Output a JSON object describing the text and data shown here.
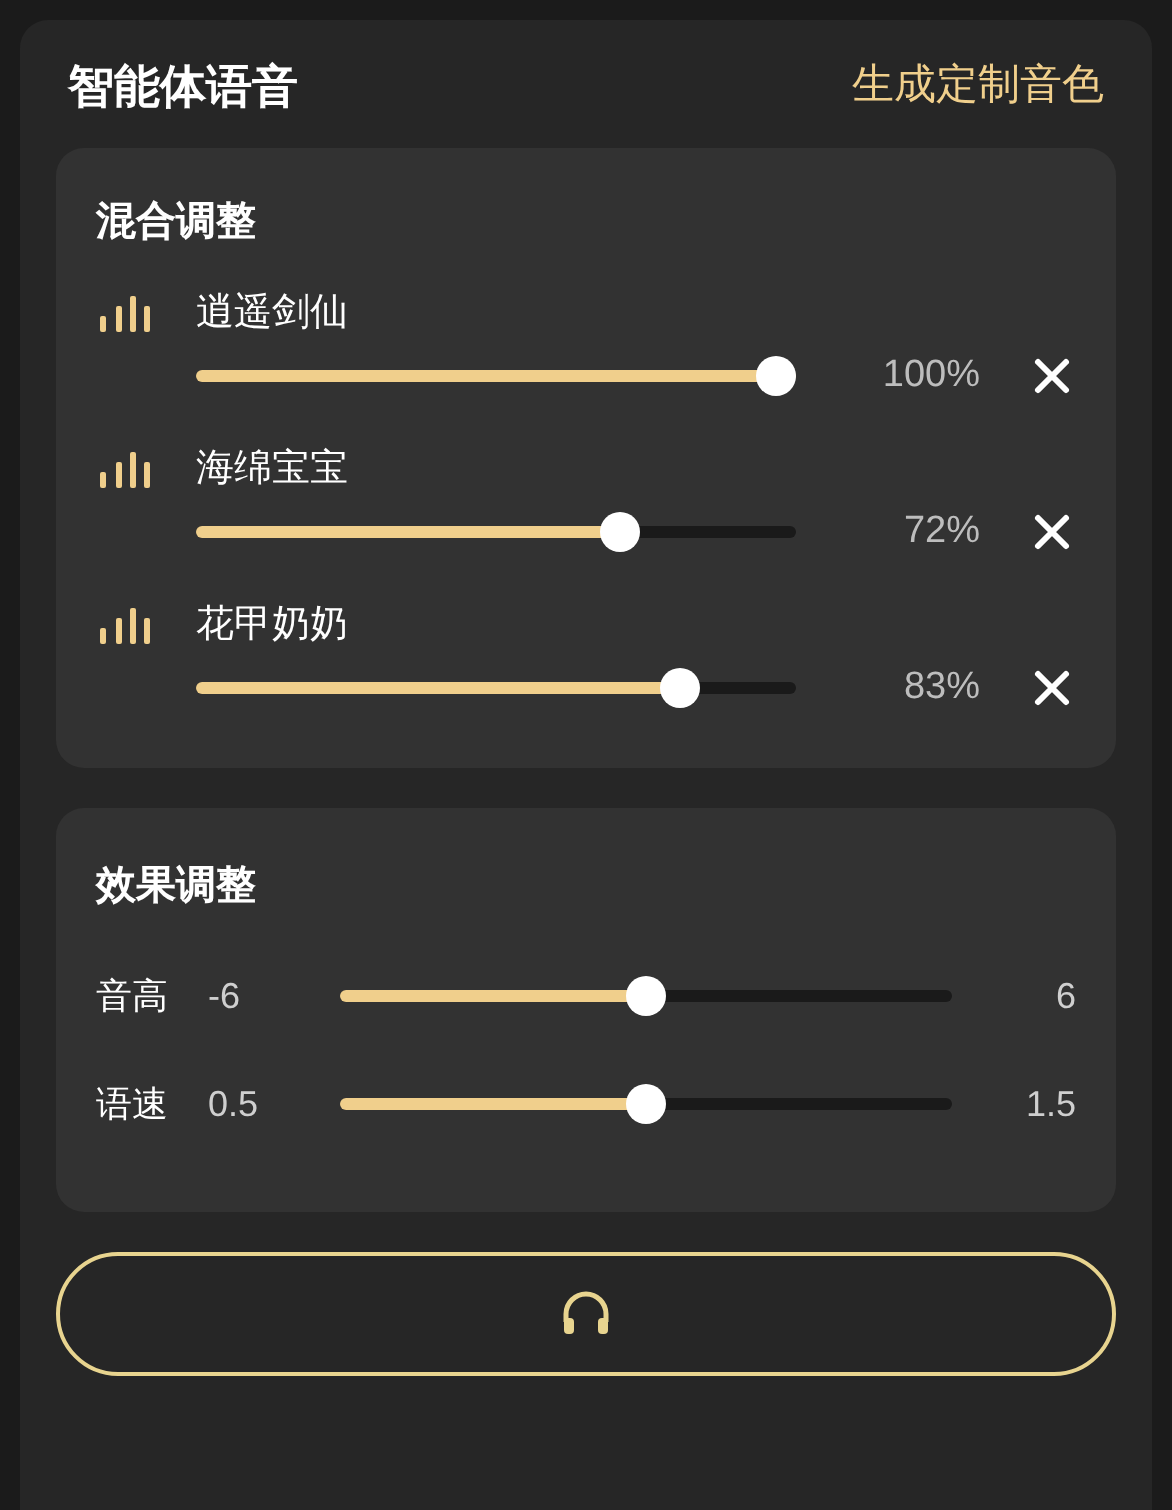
{
  "header": {
    "title": "智能体语音",
    "action": "生成定制音色"
  },
  "mix": {
    "title": "混合调整",
    "voices": [
      {
        "name": "逍遥剑仙",
        "level": 1.0,
        "reading": "100%"
      },
      {
        "name": "海绵宝宝",
        "level": 0.72,
        "reading": "72%"
      },
      {
        "name": "花甲奶奶",
        "level": 0.83,
        "reading": "83%"
      }
    ]
  },
  "effects": {
    "title": "效果调整",
    "sliders": [
      {
        "label": "音高",
        "min": "-6",
        "max": "6",
        "level": 0.5
      },
      {
        "label": "语速",
        "min": "0.5",
        "max": "1.5",
        "level": 0.5
      }
    ]
  }
}
